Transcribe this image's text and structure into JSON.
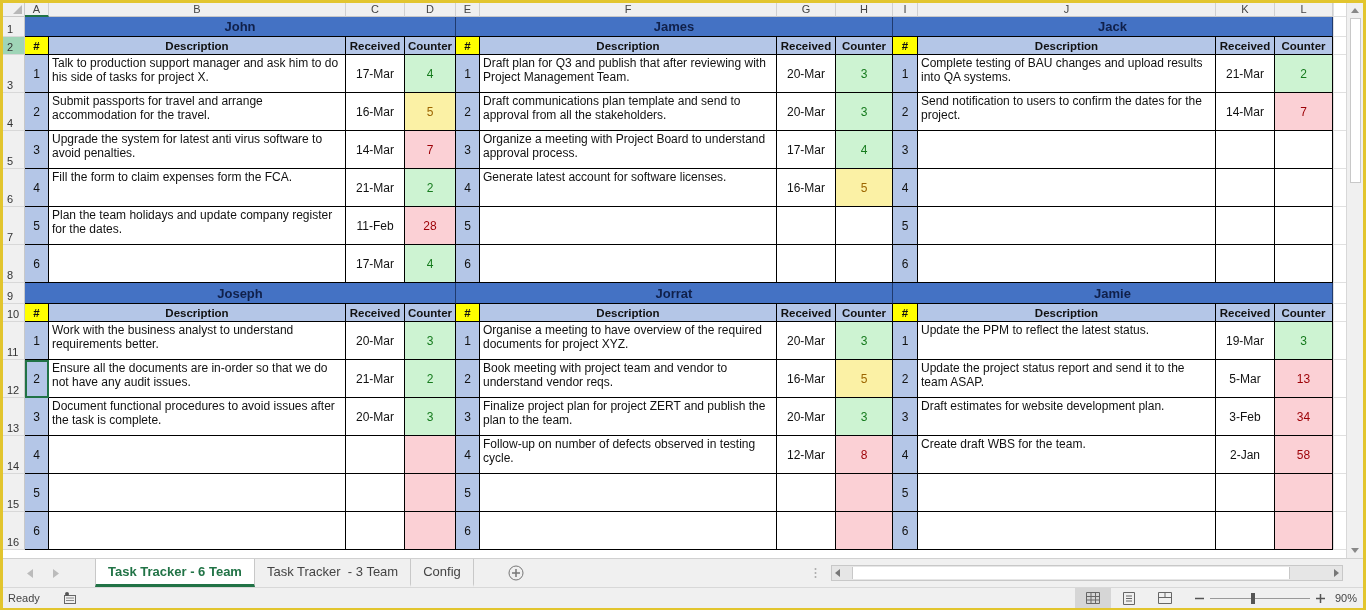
{
  "column_headers": [
    {
      "label": "A",
      "selected": true
    },
    {
      "label": "B",
      "selected": false
    },
    {
      "label": "C",
      "selected": false
    },
    {
      "label": "D",
      "selected": false
    },
    {
      "label": "E",
      "selected": false
    },
    {
      "label": "F",
      "selected": false
    },
    {
      "label": "G",
      "selected": false
    },
    {
      "label": "H",
      "selected": false
    },
    {
      "label": "I",
      "selected": false
    },
    {
      "label": "J",
      "selected": false
    },
    {
      "label": "K",
      "selected": false
    },
    {
      "label": "L",
      "selected": false
    }
  ],
  "row_headers": [
    {
      "label": "1",
      "selected": false
    },
    {
      "label": "2",
      "selected": true
    },
    {
      "label": "3",
      "selected": false
    },
    {
      "label": "4",
      "selected": false
    },
    {
      "label": "5",
      "selected": false
    },
    {
      "label": "6",
      "selected": false
    },
    {
      "label": "7",
      "selected": false
    },
    {
      "label": "8",
      "selected": false
    },
    {
      "label": "9",
      "selected": false
    },
    {
      "label": "10",
      "selected": false
    },
    {
      "label": "11",
      "selected": false
    },
    {
      "label": "12",
      "selected": false
    },
    {
      "label": "13",
      "selected": false
    },
    {
      "label": "14",
      "selected": false
    },
    {
      "label": "15",
      "selected": false
    },
    {
      "label": "16",
      "selected": false
    }
  ],
  "teams": [
    {
      "name": "John",
      "columns": [
        "#",
        "Description",
        "Received",
        "Counter"
      ],
      "tasks": [
        {
          "number": "1",
          "description": "Talk to production support manager and ask him to do his side of tasks for project X.",
          "received": "17-Mar",
          "counter": "4",
          "color": "#cdf3d2",
          "selected": false
        },
        {
          "number": "2",
          "description": "Submit passports for travel and arrange accommodation for the travel.",
          "received": "16-Mar",
          "counter": "5",
          "color": "#fbf1a5",
          "selected": false
        },
        {
          "number": "3",
          "description": "Upgrade the system for latest anti virus software to avoid penalties.",
          "received": "14-Mar",
          "counter": "7",
          "color": "#fbd0d5",
          "selected": false
        },
        {
          "number": "4",
          "description": "Fill the form to claim expenses form the FCA.",
          "received": "21-Mar",
          "counter": "2",
          "color": "#cdf3d2",
          "selected": false
        },
        {
          "number": "5",
          "description": "Plan the team holidays and update company register for the dates.",
          "received": "11-Feb",
          "counter": "28",
          "color": "#fbd0d5",
          "selected": false
        },
        {
          "number": "6",
          "received": "17-Mar",
          "counter": "4",
          "color": "#cdf3d2",
          "selected": false
        }
      ]
    },
    {
      "name": "James",
      "columns": [
        "#",
        "Description",
        "Received",
        "Counter"
      ],
      "tasks": [
        {
          "number": "1",
          "description": "Draft plan for Q3 and publish that after reviewing with Project Management Team.",
          "received": "20-Mar",
          "counter": "3",
          "color": "#cdf3d2",
          "selected": false
        },
        {
          "number": "2",
          "description": "Draft communications plan template and send to approval from all the stakeholders.",
          "received": "20-Mar",
          "counter": "3",
          "color": "#cdf3d2",
          "selected": false
        },
        {
          "number": "3",
          "description": "Organize a meeting with Project Board to understand approval process.",
          "received": "17-Mar",
          "counter": "4",
          "color": "#cdf3d2",
          "selected": false
        },
        {
          "number": "4",
          "description": "Generate latest account for software licenses.",
          "received": "16-Mar",
          "counter": "5",
          "color": "#fbf1a5",
          "selected": false
        },
        {
          "number": "5",
          "selected": false
        },
        {
          "number": "6",
          "selected": false
        }
      ]
    },
    {
      "name": "Jack",
      "columns": [
        "#",
        "Description",
        "Received",
        "Counter"
      ],
      "tasks": [
        {
          "number": "1",
          "description": "Complete testing of BAU changes and upload results into QA systems.",
          "received": "21-Mar",
          "counter": "2",
          "color": "#cdf3d2",
          "selected": false
        },
        {
          "number": "2",
          "description": "Send notification to users to confirm the dates for the project.",
          "received": "14-Mar",
          "counter": "7",
          "color": "#fbd0d5",
          "selected": false
        },
        {
          "number": "3",
          "selected": false
        },
        {
          "number": "4",
          "selected": false
        },
        {
          "number": "5",
          "selected": false
        },
        {
          "number": "6",
          "selected": false
        }
      ]
    },
    {
      "name": "Joseph",
      "columns": [
        "#",
        "Description",
        "Received",
        "Counter"
      ],
      "tasks": [
        {
          "number": "1",
          "description": "Work with the business analyst to understand requirements better.",
          "received": "20-Mar",
          "counter": "3",
          "color": "#cdf3d2",
          "selected": false
        },
        {
          "number": "2",
          "description": "Ensure all the documents are in-order so that we do not have any audit issues.",
          "received": "21-Mar",
          "counter": "2",
          "color": "#cdf3d2",
          "selected": true
        },
        {
          "number": "3",
          "description": "Document functional procedures to avoid issues after the task is complete.",
          "received": "20-Mar",
          "counter": "3",
          "color": "#cdf3d2",
          "selected": false
        },
        {
          "number": "4",
          "color": "#fbd0d5",
          "selected": false
        },
        {
          "number": "5",
          "color": "#fbd0d5",
          "selected": false
        },
        {
          "number": "6",
          "color": "#fbd0d5",
          "selected": false
        }
      ]
    },
    {
      "name": "Jorrat",
      "columns": [
        "#",
        "Description",
        "Received",
        "Counter"
      ],
      "tasks": [
        {
          "number": "1",
          "description": "Organise a meeting to have overview of the required documents for project XYZ.",
          "received": "20-Mar",
          "counter": "3",
          "color": "#cdf3d2",
          "selected": false
        },
        {
          "number": "2",
          "description": "Book meeting with project team and vendor to understand vendor reqs.",
          "received": "16-Mar",
          "counter": "5",
          "color": "#fbf1a5",
          "selected": false
        },
        {
          "number": "3",
          "description": "Finalize project plan for project ZERT and publish the plan to the team.",
          "received": "20-Mar",
          "counter": "3",
          "color": "#cdf3d2",
          "selected": false
        },
        {
          "number": "4",
          "description": "Follow-up on number of defects observed in testing cycle.",
          "received": "12-Mar",
          "counter": "8",
          "color": "#fbd0d5",
          "selected": false
        },
        {
          "number": "5",
          "color": "#fbd0d5",
          "selected": false
        },
        {
          "number": "6",
          "color": "#fbd0d5",
          "selected": false
        }
      ]
    },
    {
      "name": "Jamie",
      "columns": [
        "#",
        "Description",
        "Received",
        "Counter"
      ],
      "tasks": [
        {
          "number": "1",
          "description": "Update the PPM to reflect the latest status.",
          "received": "19-Mar",
          "counter": "3",
          "color": "#cdf3d2",
          "selected": false
        },
        {
          "number": "2",
          "description": "Update the project status report and send it to the team ASAP.",
          "received": "5-Mar",
          "counter": "13",
          "color": "#fbd0d5",
          "selected": false
        },
        {
          "number": "3",
          "description": "Draft estimates for website development plan.",
          "received": "3-Feb",
          "counter": "34",
          "color": "#fbd0d5",
          "selected": false
        },
        {
          "number": "4",
          "description": "Create draft WBS for the team.",
          "received": "2-Jan",
          "counter": "58",
          "color": "#fbd0d5",
          "selected": false
        },
        {
          "number": "5",
          "color": "#fbd0d5",
          "selected": false
        },
        {
          "number": "6",
          "color": "#fbd0d5",
          "selected": false
        }
      ]
    }
  ],
  "sheet_tabs": [
    {
      "label": "Task Tracker - 6 Team",
      "selected": true
    },
    {
      "label": "Task Tracker  - 3 Team",
      "selected": false
    },
    {
      "label": "Config",
      "selected": false
    }
  ],
  "status_bar": {
    "status": "Ready",
    "zoom": "90%",
    "level": 0.41,
    "views": [
      {
        "kind": "normal",
        "selected": true
      },
      {
        "kind": "page-layout",
        "selected": false
      },
      {
        "kind": "page-break",
        "selected": false
      }
    ]
  }
}
